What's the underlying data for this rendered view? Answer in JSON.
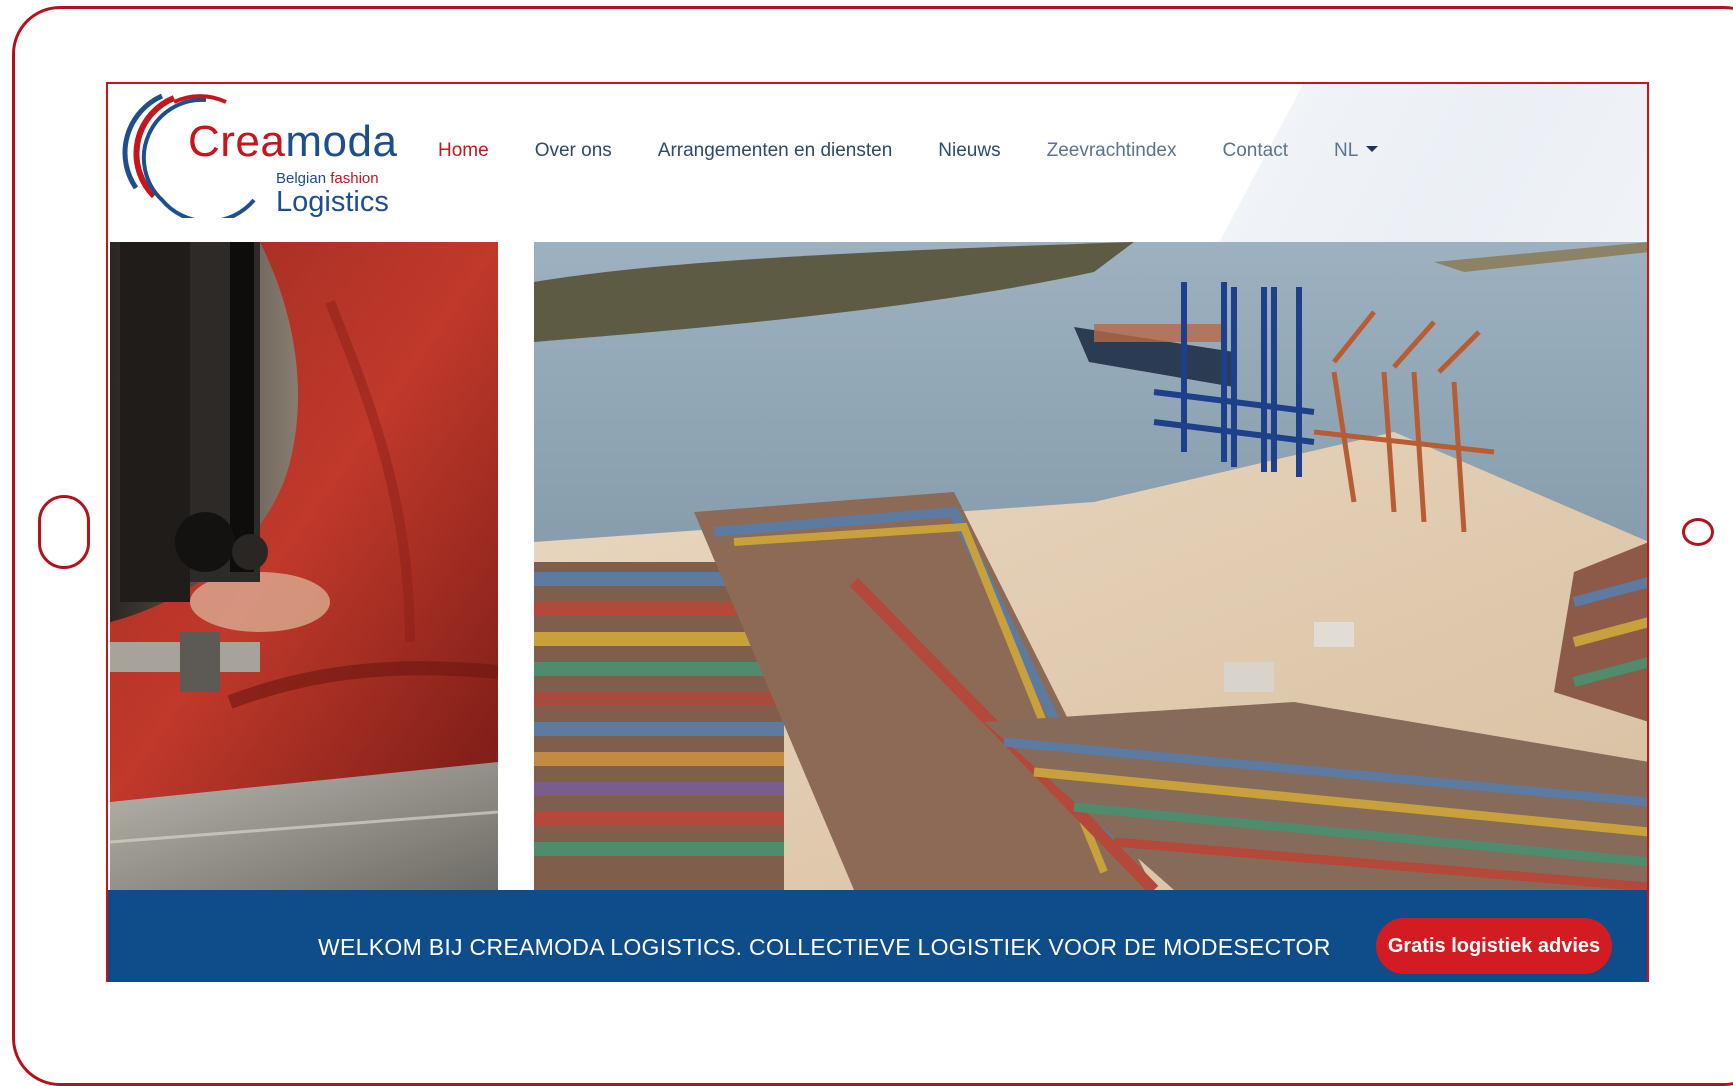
{
  "logo": {
    "crea": "Crea",
    "moda": "moda",
    "tag_belgian": "Belgian",
    "tag_fashion": "fashion",
    "logistics": "Logistics"
  },
  "nav": {
    "items": [
      {
        "label": "Home",
        "active": true
      },
      {
        "label": "Over ons",
        "active": false
      },
      {
        "label": "Arrangementen en diensten",
        "active": false
      },
      {
        "label": "Nieuws",
        "active": false
      },
      {
        "label": "Zeevrachtindex",
        "active": false
      },
      {
        "label": "Contact",
        "active": false
      }
    ],
    "language": "NL"
  },
  "hero": {
    "left_image": "sewing-machine-red-fabric-photo",
    "right_image": "container-port-aerial-photo"
  },
  "banner": {
    "text": "WELKOM BIJ CREAMODA LOGISTICS. COLLECTIEVE LOGISTIEK VOOR DE MODESECTOR",
    "cta_label": "Gratis logistiek advies"
  },
  "colors": {
    "frame": "#b3121d",
    "brand_red": "#c4161c",
    "brand_blue": "#1d4f8f",
    "banner_blue": "#0f4c8a",
    "cta_red": "#d31b24"
  }
}
